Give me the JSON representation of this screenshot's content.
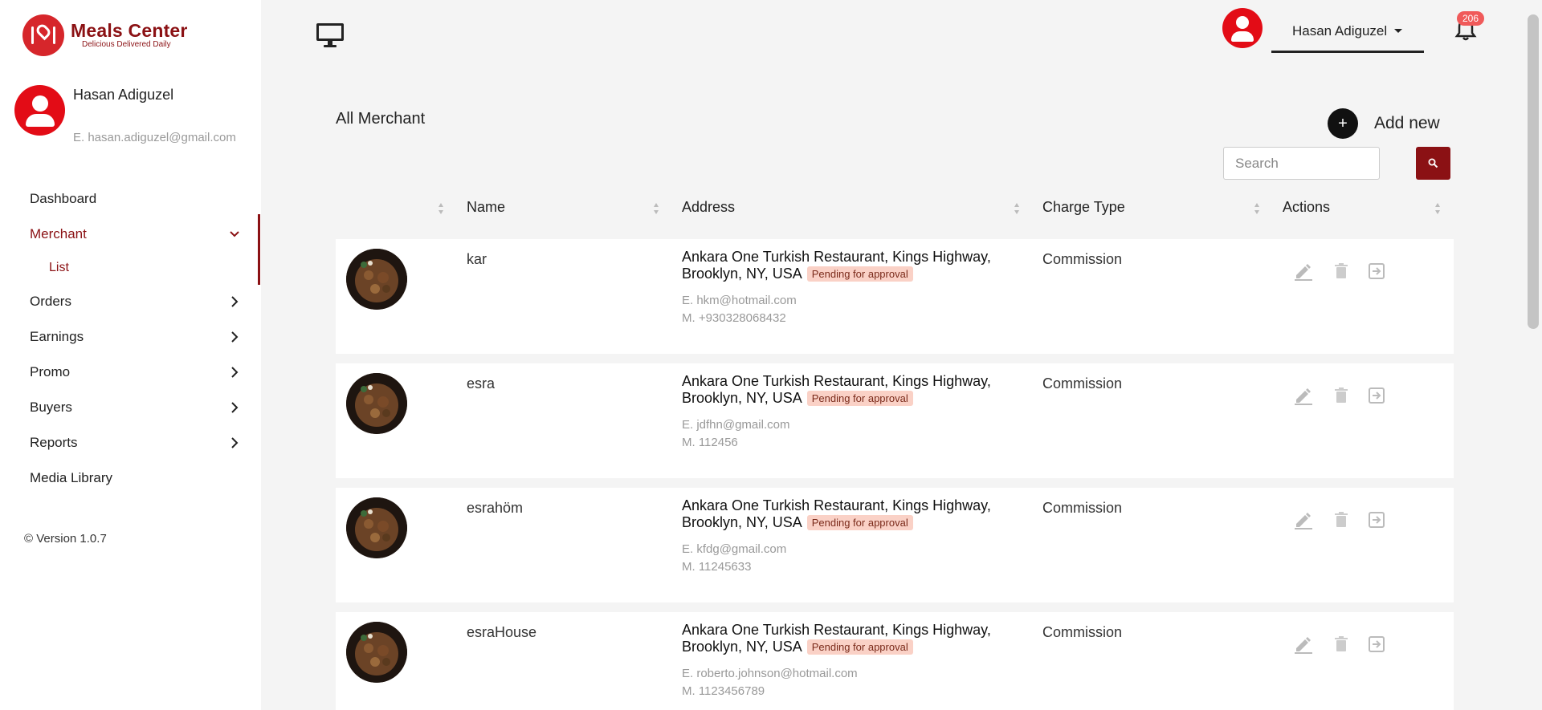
{
  "brand": {
    "title": "Meals Center",
    "tagline": "Delicious Delivered Daily",
    "accent": "#8b1114",
    "red": "#e30c16"
  },
  "profile": {
    "name": "Hasan Adiguzel",
    "email": "E. hasan.adiguzel@gmail.com"
  },
  "nav": {
    "items": [
      {
        "label": "Dashboard"
      },
      {
        "label": "Merchant",
        "expanded": true
      },
      {
        "label": "List"
      },
      {
        "label": "Orders"
      },
      {
        "label": "Earnings"
      },
      {
        "label": "Promo"
      },
      {
        "label": "Buyers"
      },
      {
        "label": "Reports"
      },
      {
        "label": "Media Library"
      }
    ]
  },
  "version": "© Version 1.0.7",
  "topbar": {
    "user_name": "Hasan Adiguzel",
    "notification_count": "206",
    "monitor_icon": "desktop-icon",
    "bell_icon": "bell-icon"
  },
  "main": {
    "title": "All Merchant",
    "add_new_label": "Add new",
    "add_new_icon": "+",
    "search_placeholder": "Search",
    "columns": [
      "",
      "Name",
      "Address",
      "Charge Type",
      "Actions"
    ]
  },
  "merchants": [
    {
      "name": "kar",
      "address": "Ankara One Turkish Restaurant, Kings Highway, Brooklyn, NY, USA",
      "status": "Pending for approval",
      "email": "E. hkm@hotmail.com",
      "mobile": "M. +930328068432",
      "charge_type": "Commission"
    },
    {
      "name": "esra",
      "address": "Ankara One Turkish Restaurant, Kings Highway, Brooklyn, NY, USA",
      "status": "Pending for approval",
      "email": "E. jdfhn@gmail.com",
      "mobile": "M. 112456",
      "charge_type": "Commission"
    },
    {
      "name": "esrahöm",
      "address": "Ankara One Turkish Restaurant, Kings Highway, Brooklyn, NY, USA",
      "status": "Pending for approval",
      "email": "E. kfdg@gmail.com",
      "mobile": "M. 11245633",
      "charge_type": "Commission"
    },
    {
      "name": "esraHouse",
      "address": "Ankara One Turkish Restaurant, Kings Highway, Brooklyn, NY, USA",
      "status": "Pending for approval",
      "email": "E. roberto.johnson@hotmail.com",
      "mobile": "M. 1123456789",
      "charge_type": "Commission"
    }
  ]
}
